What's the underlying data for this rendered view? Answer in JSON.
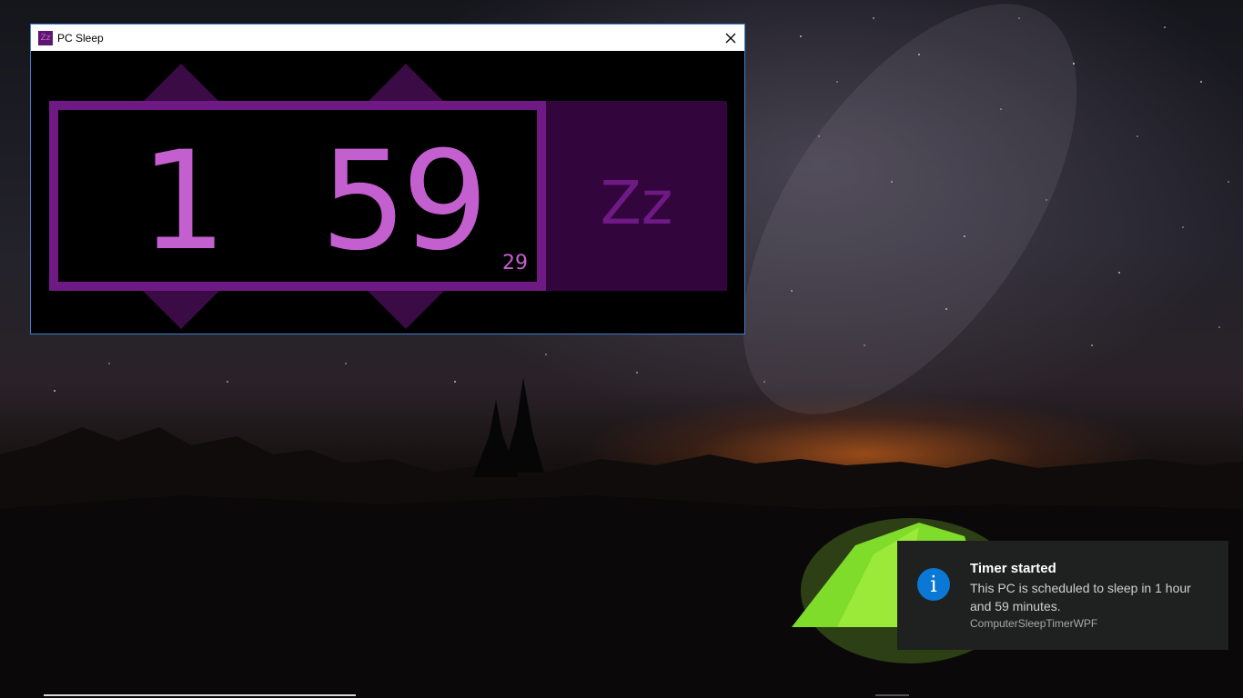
{
  "window": {
    "title": "PC Sleep",
    "icon": "zz-app-icon",
    "close_icon": "close-icon"
  },
  "timer": {
    "hours": "1",
    "minutes": "59",
    "seconds": "29"
  },
  "sleep_button": {
    "label": "Zz"
  },
  "notification": {
    "icon": "info-icon",
    "icon_glyph": "i",
    "title": "Timer started",
    "body": "This PC is scheduled to sleep in 1 hour and 59 minutes.",
    "source": "ComputerSleepTimerWPF"
  },
  "colors": {
    "accent": "#c45fcf",
    "frame": "#6e1984",
    "sleep_bg": "#32053d",
    "arrow": "#3a0b45",
    "info_blue": "#0a78d4"
  }
}
